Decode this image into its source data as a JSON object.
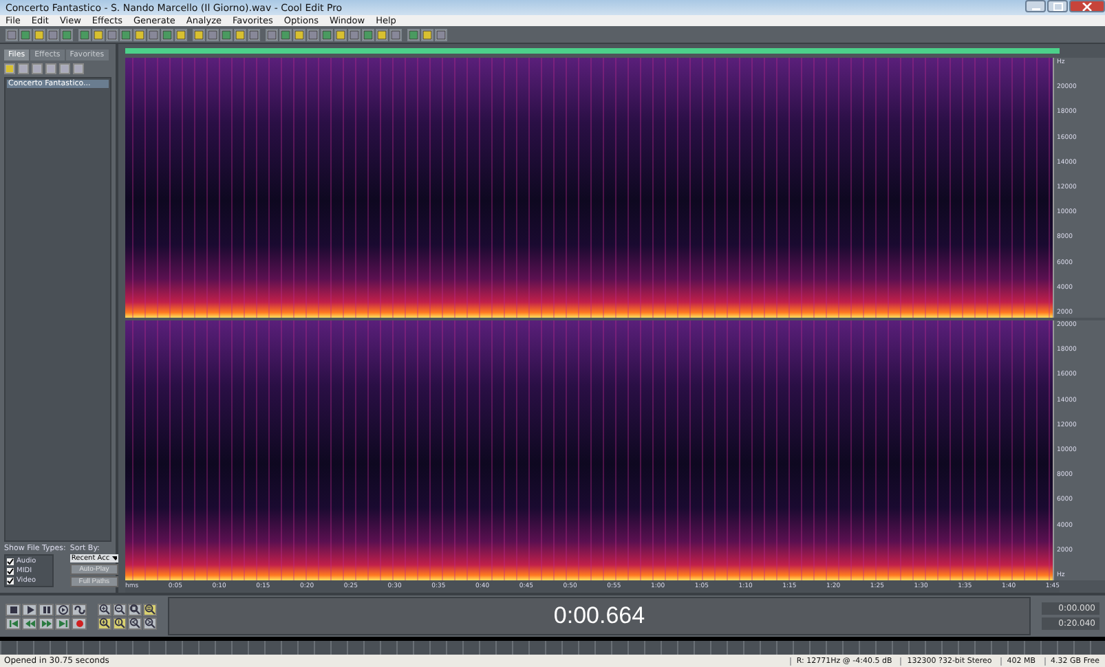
{
  "window": {
    "title": "Concerto Fantastico - S. Nando Marcello (Il Giorno).wav - Cool Edit Pro"
  },
  "menu": [
    "File",
    "Edit",
    "View",
    "Effects",
    "Generate",
    "Analyze",
    "Favorites",
    "Options",
    "Window",
    "Help"
  ],
  "sidebar": {
    "tabs": [
      {
        "label": "Files",
        "selected": true
      },
      {
        "label": "Effects",
        "selected": false
      },
      {
        "label": "Favorites",
        "selected": false
      }
    ],
    "files": [
      {
        "name": "Concerto Fantastico...",
        "selected": true
      }
    ],
    "show_file_types_label": "Show File Types:",
    "sort_by_label": "Sort By:",
    "file_types": [
      {
        "label": "Audio",
        "checked": true
      },
      {
        "label": "MIDI",
        "checked": true
      },
      {
        "label": "Video",
        "checked": true
      }
    ],
    "sort_value": "Recent Acc",
    "buttons": [
      "Auto-Play",
      "Full Paths"
    ]
  },
  "editor": {
    "channels": [
      {
        "freq_labels": [
          "Hz",
          "20000",
          "18000",
          "16000",
          "14000",
          "12000",
          "10000",
          "8000",
          "6000",
          "4000",
          "2000"
        ]
      },
      {
        "freq_labels": [
          "20000",
          "18000",
          "16000",
          "14000",
          "12000",
          "10000",
          "8000",
          "6000",
          "4000",
          "2000",
          "Hz"
        ]
      }
    ],
    "time_labels": [
      "hms",
      "0:05",
      "0:10",
      "0:15",
      "0:20",
      "0:25",
      "0:30",
      "0:35",
      "0:40",
      "0:45",
      "0:50",
      "0:55",
      "1:00",
      "1:05",
      "1:10",
      "1:15",
      "1:20",
      "1:25",
      "1:30",
      "1:35",
      "1:40",
      "1:45"
    ]
  },
  "transport": [
    {
      "kind": "stop"
    },
    {
      "kind": "play"
    },
    {
      "kind": "pause"
    },
    {
      "kind": "play-to-end"
    },
    {
      "kind": "loop"
    },
    {
      "kind": "go-start"
    },
    {
      "kind": "rewind"
    },
    {
      "kind": "forward"
    },
    {
      "kind": "go-end"
    },
    {
      "kind": "record"
    }
  ],
  "zoom": [
    {
      "kind": "zoom-in-h"
    },
    {
      "kind": "zoom-out-h"
    },
    {
      "kind": "zoom-full"
    },
    {
      "kind": "zoom-sel"
    },
    {
      "kind": "zoom-in-v"
    },
    {
      "kind": "zoom-out-v"
    },
    {
      "kind": "zoom-left"
    },
    {
      "kind": "zoom-right"
    }
  ],
  "time_display": "0:00.664",
  "selection": {
    "begin": "0:00.000",
    "end": "0:20.040"
  },
  "status_bar": {
    "message": "Opened in 30.75 seconds",
    "fields": [
      "R: 12771Hz @ -4:40.5 dB",
      "132300 ?32-bit Stereo",
      "402 MB",
      "4.32 GB Free"
    ]
  }
}
